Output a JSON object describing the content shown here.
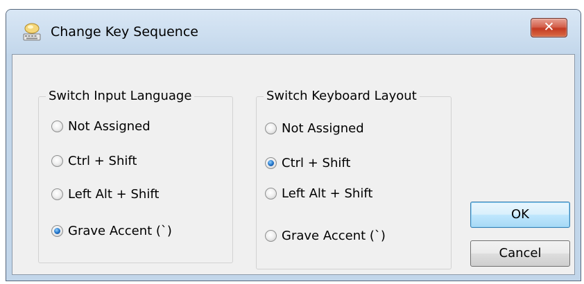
{
  "window": {
    "title": "Change Key Sequence",
    "close_label": "✕"
  },
  "groups": {
    "input_language": {
      "title": "Switch Input Language",
      "options": [
        {
          "label": "Not Assigned",
          "checked": false
        },
        {
          "label": "Ctrl + Shift",
          "checked": false
        },
        {
          "label": "Left Alt + Shift",
          "checked": false
        },
        {
          "label": "Grave Accent (`)",
          "checked": true
        }
      ]
    },
    "keyboard_layout": {
      "title": "Switch Keyboard Layout",
      "options": [
        {
          "label": "Not Assigned",
          "checked": false
        },
        {
          "label": "Ctrl + Shift",
          "checked": true
        },
        {
          "label": "Left Alt + Shift",
          "checked": false
        },
        {
          "label": "Grave Accent (`)",
          "checked": false
        }
      ]
    }
  },
  "buttons": {
    "ok": "OK",
    "cancel": "Cancel"
  }
}
